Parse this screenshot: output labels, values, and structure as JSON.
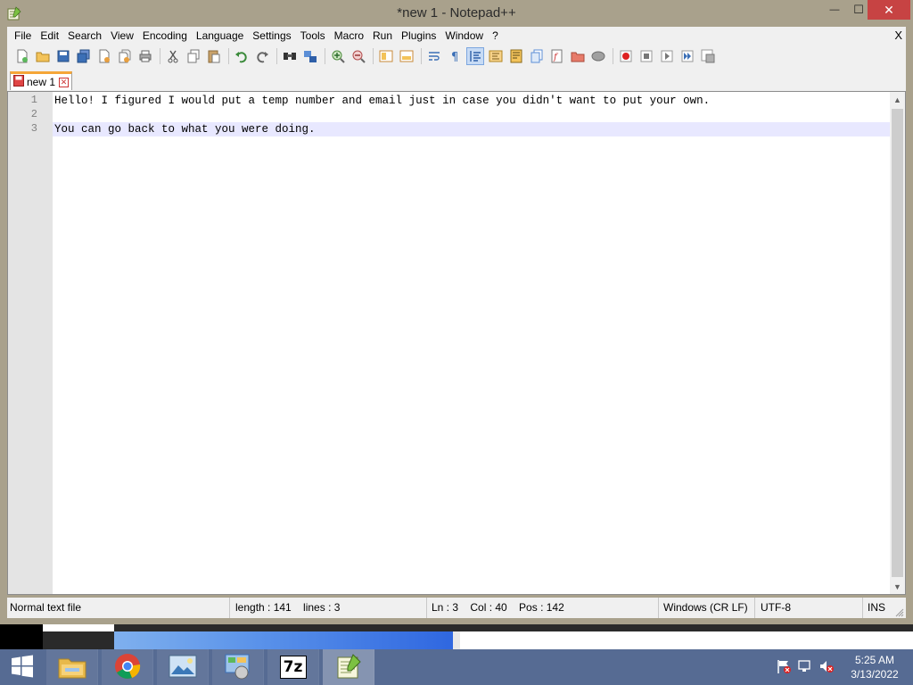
{
  "window": {
    "title": "*new 1 - Notepad++",
    "close_glyph": "✕",
    "minimize_glyph": "—",
    "maximize_glyph": "☐"
  },
  "menubar": {
    "items": [
      "File",
      "Edit",
      "Search",
      "View",
      "Encoding",
      "Language",
      "Settings",
      "Tools",
      "Macro",
      "Run",
      "Plugins",
      "Window",
      "?"
    ],
    "close_doc_label": "X"
  },
  "toolbar": {
    "icons": [
      "new-file-icon",
      "open-file-icon",
      "save-icon",
      "save-all-icon",
      "close-icon",
      "close-all-icon",
      "print-icon",
      "cut-icon",
      "copy-icon",
      "paste-icon",
      "undo-icon",
      "redo-icon",
      "find-icon",
      "replace-icon",
      "zoom-in-icon",
      "zoom-out-icon",
      "sync-vertical-icon",
      "sync-horizontal-icon",
      "word-wrap-icon",
      "show-all-characters-icon",
      "indent-guide-icon",
      "user-defined-language-icon",
      "document-map-icon",
      "document-list-icon",
      "function-list-icon",
      "folder-as-workspace-icon",
      "monitoring-icon",
      "record-macro-icon",
      "stop-macro-icon",
      "play-macro-icon",
      "run-macro-multiple-icon",
      "save-macro-icon"
    ]
  },
  "tabs": [
    {
      "label": "new 1",
      "modified": true,
      "active": true
    }
  ],
  "editor": {
    "lines": [
      {
        "number": "1",
        "text": "Hello! I figured I would put a temp number and email just in case you didn't want to put your own."
      },
      {
        "number": "2",
        "text": ""
      },
      {
        "number": "3",
        "text": "You can go back to what you were doing."
      }
    ],
    "current_line_color": "#e8e8ff"
  },
  "statusbar": {
    "file_type": "Normal text file",
    "length": "length : 141    lines : 3",
    "position": "Ln : 3    Col : 40    Pos : 142",
    "eol": "Windows (CR LF)",
    "encoding": "UTF-8",
    "mode": "INS"
  },
  "taskbar": {
    "apps": [
      "file-explorer-icon",
      "chrome-icon",
      "photo-viewer-icon",
      "control-panel-icon",
      "7zip-icon",
      "notepadpp-icon"
    ],
    "seven_zip_label": "7z",
    "tray_icons": [
      "action-center-flag-icon",
      "network-icon",
      "volume-muted-icon"
    ],
    "time": "5:25 AM",
    "date": "3/13/2022"
  },
  "colors": {
    "window_frame": "#a9a18c",
    "taskbar": "#566b93",
    "close_button": "#c74343",
    "tab_accent": "#f5a638"
  }
}
